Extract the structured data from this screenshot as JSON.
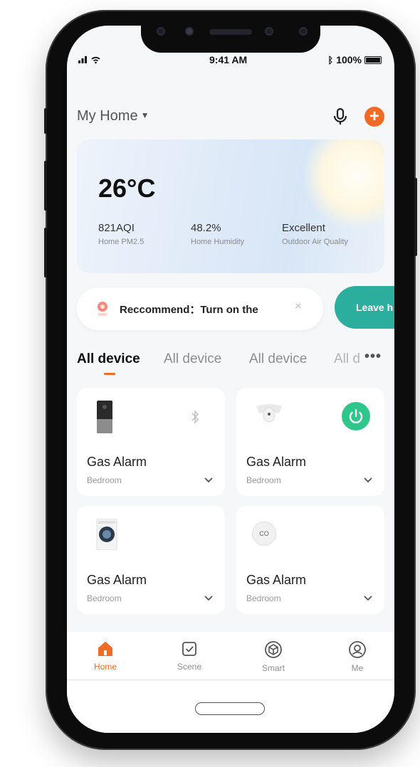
{
  "status_bar": {
    "time": "9:41 AM",
    "battery": "100%"
  },
  "header": {
    "home_name": "My Home"
  },
  "weather": {
    "temperature": "26°C",
    "stats": [
      {
        "value": "821AQI",
        "label": "Home PM2.5"
      },
      {
        "value": "48.2%",
        "label": "Home Humidity"
      },
      {
        "value": "Excellent",
        "label": "Outdoor Air Quality"
      }
    ]
  },
  "recommend": {
    "text": "Reccommend：Turn on the",
    "close": "×",
    "action_label": "Leave h"
  },
  "tabs": [
    "All device",
    "All device",
    "All device",
    "All d"
  ],
  "devices": [
    {
      "name": "Gas Alarm",
      "room": "Bedroom",
      "status_icon": "bluetooth-icon"
    },
    {
      "name": "Gas Alarm",
      "room": "Bedroom",
      "status_icon": "power-icon"
    },
    {
      "name": "Gas Alarm",
      "room": "Bedroom",
      "status_icon": ""
    },
    {
      "name": "Gas Alarm",
      "room": "Bedroom",
      "status_icon": "",
      "badge": "CO"
    }
  ],
  "nav": [
    {
      "label": "Home",
      "icon": "home-icon"
    },
    {
      "label": "Scene",
      "icon": "scene-icon"
    },
    {
      "label": "Smart",
      "icon": "smart-icon"
    },
    {
      "label": "Me",
      "icon": "profile-icon"
    }
  ],
  "colors": {
    "accent": "#f36a25",
    "teal": "#2bae9e",
    "power_green": "#2fc68c"
  }
}
